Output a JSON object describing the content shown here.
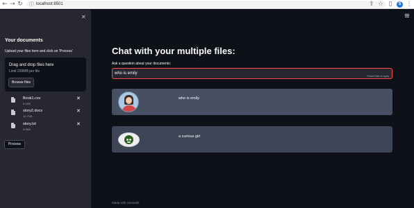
{
  "browser": {
    "url": "localhost:8501",
    "profile_initial": "S"
  },
  "sidebar": {
    "title": "Your documents",
    "instructions": "Upload your files here and click on 'Process'",
    "uploader": {
      "title": "Drag and drop files here",
      "limit": "Limit 200MB per file",
      "browse_label": "Browse files"
    },
    "files": [
      {
        "name": "Book1.csv",
        "size": "6.1KB"
      },
      {
        "name": "story2.docx",
        "size": "10.7KB"
      },
      {
        "name": "story.txt",
        "size": "0.9KB"
      }
    ],
    "process_label": "Process"
  },
  "main": {
    "title": "Chat with your multiple files:",
    "question_label": "Ask a question about your documents:",
    "question_value": "who is emily",
    "input_hint": "Press Enter to apply",
    "messages": [
      {
        "role": "user",
        "text": "who is emily"
      },
      {
        "role": "bot",
        "text": "a curious girl"
      }
    ],
    "footer": "Made with Streamlit"
  },
  "colors": {
    "app_bg": "#0e1117",
    "sidebar_bg": "#262730",
    "accent": "#ff4b4b",
    "user_msg_bg": "#475063",
    "bot_msg_bg": "#3e4556"
  }
}
